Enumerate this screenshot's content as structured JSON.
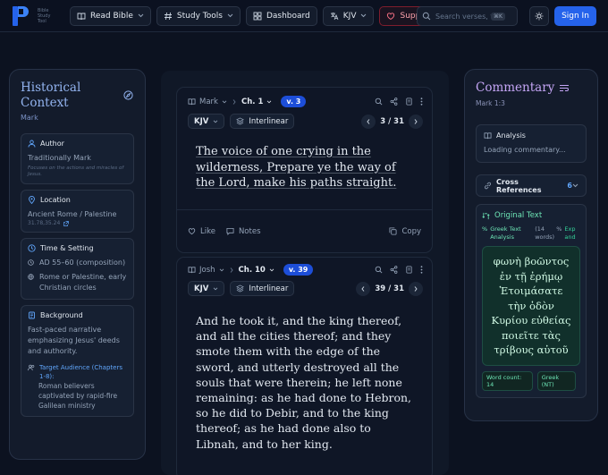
{
  "header": {
    "logo_text": "Bible Study Tool",
    "nav": [
      {
        "label": "Read Bible",
        "icon": "book-icon",
        "has_dropdown": true
      },
      {
        "label": "Study Tools",
        "icon": "hash-icon",
        "has_dropdown": true
      },
      {
        "label": "Dashboard",
        "icon": "grid-icon",
        "has_dropdown": false
      },
      {
        "label": "KJV",
        "icon": "translate-icon",
        "has_dropdown": true
      },
      {
        "label": "Support",
        "icon": "heart-icon",
        "has_dropdown": false
      }
    ],
    "search_placeholder": "Search verses, to",
    "search_shortcut": "⌘K",
    "signin_label": "Sign In",
    "colors": {
      "accent": "#2563eb",
      "support": "#fb7185"
    }
  },
  "historical": {
    "title": "Historical Context",
    "book": "Mark",
    "author": {
      "heading": "Author",
      "value": "Traditionally Mark",
      "note": "Focuses on the actions and miracles of Jesus."
    },
    "location": {
      "heading": "Location",
      "value": "Ancient Rome / Palestine",
      "coords": "31.78,35.24"
    },
    "time": {
      "heading": "Time & Setting",
      "date": "AD 55–60 (composition)",
      "place": "Rome or Palestine, early Christian circles"
    },
    "background": {
      "heading": "Background",
      "text": "Fast-paced narrative emphasizing Jesus' deeds and authority.",
      "audience_heading": "Target Audience (Chapters 1-8):",
      "audience_text": "Roman believers captivated by rapid-fire Galilean ministry"
    }
  },
  "verses": [
    {
      "book": "Mark",
      "chapter": "Ch. 1",
      "verse": "v. 3",
      "translation": "KJV",
      "interlinear": "Interlinear",
      "page": "3 / 31",
      "text": "The voice of one crying in the wilderness, Prepare ye the way of the Lord, make his paths straight.",
      "like_label": "Like",
      "notes_label": "Notes",
      "copy_label": "Copy"
    },
    {
      "book": "Josh",
      "chapter": "Ch. 10",
      "verse": "v. 39",
      "translation": "KJV",
      "interlinear": "Interlinear",
      "page": "39 / 31",
      "text": "And he took it, and the king thereof, and all the cities thereof; and they smote them with the edge of the sword, and utterly destroyed all the souls that were therein; he left none remaining: as he had done to Hebron, so he did to Debir, and to the king thereof; as he had done also to Libnah, and to her king."
    }
  ],
  "commentary": {
    "title": "Commentary",
    "ref": "Mark 1:3",
    "analysis_heading": "Analysis",
    "analysis_text": "Loading commentary...",
    "cross_refs_label": "Cross References",
    "cross_refs_count": "6",
    "original_heading": "Original Text",
    "greek_analysis_label": "Greek Text Analysis",
    "greek_word_count_paren": "(14 words)",
    "expand_label": "Expand",
    "greek_lines": [
      "φωνὴ βοῶντος",
      "ἐν τῇ ἐρήμῳ",
      "Ἑτοιμάσατε",
      "τὴν ὁδὸν",
      "Κυρίου εὐθείας",
      "ποιεῖτε τὰς",
      "τρίβους αὐτοῦ"
    ],
    "word_count_label": "Word count: 14",
    "language_label": "Greek (NT)"
  }
}
